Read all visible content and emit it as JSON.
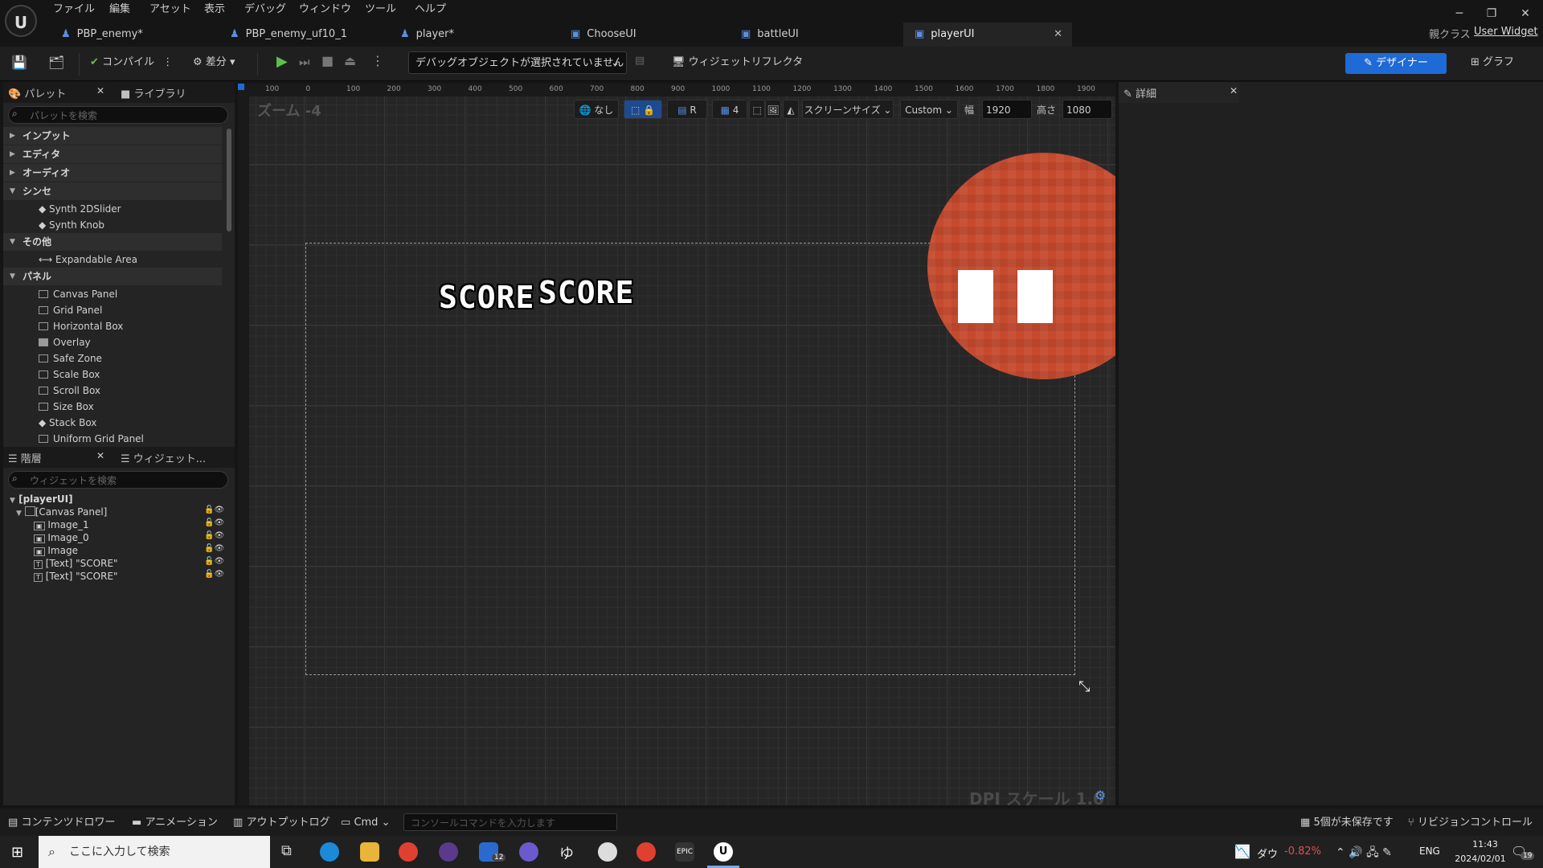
{
  "menu": [
    "ファイル",
    "編集",
    "アセット",
    "表示",
    "デバッグ",
    "ウィンドウ",
    "ツール",
    "ヘルプ"
  ],
  "tabs": [
    {
      "label": "PBP_enemy*"
    },
    {
      "label": "PBP_enemy_uf10_1"
    },
    {
      "label": "player*"
    },
    {
      "label": "ChooseUI"
    },
    {
      "label": "battleUI"
    },
    {
      "label": "playerUI",
      "active": true
    }
  ],
  "parent_class": {
    "label": "親クラス",
    "value": "User Widget"
  },
  "toolbar": {
    "compile": "コンパイル",
    "diff": "差分",
    "debug_select": "デバッグオブジェクトが選択されていません",
    "widget_reflector": "ウィジェットリフレクタ",
    "designer": "デザイナー",
    "graph": "グラフ"
  },
  "palette": {
    "tab_palette": "パレット",
    "tab_library": "ライブラリ",
    "search_placeholder": "パレットを検索",
    "categories": [
      "インプット",
      "エディタ",
      "オーディオ",
      "シンセ",
      "その他",
      "パネル"
    ],
    "synth_items": [
      "Synth 2DSlider",
      "Synth Knob"
    ],
    "other_items": [
      "Expandable Area"
    ],
    "panel_items": [
      "Canvas Panel",
      "Grid Panel",
      "Horizontal Box",
      "Overlay",
      "Safe Zone",
      "Scale Box",
      "Scroll Box",
      "Size Box",
      "Stack Box",
      "Uniform Grid Panel"
    ]
  },
  "hierarchy": {
    "tab_hierarchy": "階層",
    "tab_widget": "ウィジェット...",
    "search_placeholder": "ウィジェットを検索",
    "root": "[playerUI]",
    "canvas": "[Canvas Panel]",
    "children": [
      "Image_1",
      "Image_0",
      "Image",
      "[Text] \"SCORE\"",
      "[Text] \"SCORE\""
    ]
  },
  "viewport": {
    "zoom": "ズーム -4",
    "dpi": "DPI スケール 1.0",
    "none_label": "なし",
    "r_label": "R",
    "grid_snap": "4",
    "screen_size": "スクリーンサイズ",
    "custom": "Custom",
    "width_label": "幅",
    "width_value": "1920",
    "height_label": "高さ",
    "height_value": "1080",
    "score_text_1": "SCORE",
    "score_text_2": "SCORE",
    "ruler_top": [
      "100",
      "0",
      "100",
      "200",
      "300",
      "400",
      "500",
      "600",
      "700",
      "800",
      "900",
      "1000",
      "1100",
      "1200",
      "1300",
      "1400",
      "1500",
      "1600",
      "1700",
      "1800",
      "1900",
      "200"
    ]
  },
  "details": {
    "title": "詳細"
  },
  "bottom": {
    "content_drawer": "コンテンツドロワー",
    "animation": "アニメーション",
    "output_log": "アウトプットログ",
    "cmd": "Cmd",
    "console_placeholder": "コンソールコマンドを入力します",
    "unsaved": "5個が未保存です",
    "revision": "リビジョンコントロール"
  },
  "taskbar": {
    "search_placeholder": "ここに入力して検索",
    "stock_label": "ダウ",
    "stock_change": "-0.82%",
    "lang": "ENG",
    "time": "11:43",
    "date": "2024/02/01",
    "notif_count": "19",
    "mail_badge": "12"
  },
  "colors": {
    "accent": "#1e6ad6",
    "enemy_red": "#c64a2e",
    "stock_red": "#e05050"
  }
}
